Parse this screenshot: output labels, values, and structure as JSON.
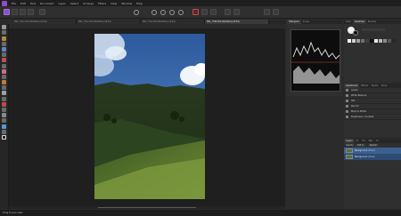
{
  "menubar": {
    "items": [
      "File",
      "Edit",
      "Text",
      "Document",
      "Layer",
      "Select",
      "Arrange",
      "Filters",
      "View",
      "Window",
      "Help"
    ]
  },
  "tabs": [
    {
      "label": "IMG_7710.CR2 [Modified] (20.2%)",
      "active": false
    },
    {
      "label": "IMG_7719.CR2 [Modified] (26.5%)",
      "active": false
    },
    {
      "label": "IMG_7742.CR2 [Modified] (19.4%)",
      "active": false
    },
    {
      "label": "IMG_7748.CR2 [Modified] (18.3%)",
      "active": true
    }
  ],
  "right_top": {
    "tabs": [
      "Histogram",
      "Scope",
      "Color",
      "Swatches",
      "Brushes"
    ]
  },
  "adjustment": {
    "tabs": [
      "Adjustment",
      "Effects",
      "Styles",
      "Stock"
    ],
    "items": [
      "Levels",
      "White Balance",
      "HSL",
      "Recolor",
      "Black & White",
      "Brightness / Contrast"
    ]
  },
  "layers": {
    "tabs": [
      "Layers",
      "Fx",
      "Tra",
      "Nav",
      "Hi"
    ],
    "opacity_label": "Opacity:",
    "opacity_value": "100 %",
    "blend_mode": "Normal",
    "items": [
      {
        "name": "Background",
        "type": "(Pixel)",
        "selected": true
      },
      {
        "name": "Background",
        "type": "(Pixel)",
        "selected": false
      }
    ]
  },
  "status": {
    "text": "Drag to pan view."
  },
  "colors": {
    "accent": "#8a4fc6",
    "selection": "#3c5f8f",
    "sky": "#3c6aa8",
    "hill": "#2e4620"
  }
}
